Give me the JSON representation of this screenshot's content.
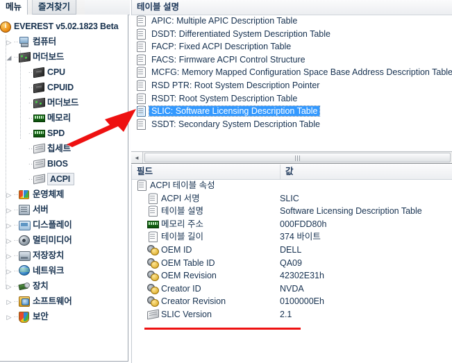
{
  "window": {
    "title": "EVEREST v5.02.1823 Beta"
  },
  "sidebar": {
    "tabs": [
      {
        "label": "메뉴",
        "active": true
      },
      {
        "label": "즐겨찾기",
        "active": false
      }
    ],
    "root": {
      "label": "EVEREST v5.02.1823 Beta",
      "icon": "info-icon"
    },
    "items": [
      {
        "label": "컴퓨터",
        "icon": "computer-icon",
        "level": 1,
        "expander": "collapsed",
        "selected": false
      },
      {
        "label": "머더보드",
        "icon": "motherboard-icon",
        "level": 1,
        "expander": "expanded",
        "selected": false
      },
      {
        "label": "CPU",
        "icon": "cpu-icon",
        "level": 2,
        "expander": "none",
        "selected": false
      },
      {
        "label": "CPUID",
        "icon": "cpu-icon",
        "level": 2,
        "expander": "none",
        "selected": false
      },
      {
        "label": "머더보드",
        "icon": "motherboard-icon",
        "level": 2,
        "expander": "none",
        "selected": false
      },
      {
        "label": "메모리",
        "icon": "memory-icon",
        "level": 2,
        "expander": "none",
        "selected": false
      },
      {
        "label": "SPD",
        "icon": "memory-icon",
        "level": 2,
        "expander": "none",
        "selected": false
      },
      {
        "label": "칩세트",
        "icon": "chipset-icon",
        "level": 2,
        "expander": "none",
        "selected": false
      },
      {
        "label": "BIOS",
        "icon": "chipset-icon",
        "level": 2,
        "expander": "none",
        "selected": false
      },
      {
        "label": "ACPI",
        "icon": "chipset-icon",
        "level": 2,
        "expander": "none",
        "selected": true
      },
      {
        "label": "운영체제",
        "icon": "windows-icon",
        "level": 1,
        "expander": "collapsed",
        "selected": false
      },
      {
        "label": "서버",
        "icon": "server-icon",
        "level": 1,
        "expander": "collapsed",
        "selected": false
      },
      {
        "label": "디스플레이",
        "icon": "display-icon",
        "level": 1,
        "expander": "collapsed",
        "selected": false
      },
      {
        "label": "멀티미디어",
        "icon": "multimedia-icon",
        "level": 1,
        "expander": "collapsed",
        "selected": false
      },
      {
        "label": "저장장치",
        "icon": "storage-icon",
        "level": 1,
        "expander": "collapsed",
        "selected": false
      },
      {
        "label": "네트워크",
        "icon": "network-icon",
        "level": 1,
        "expander": "collapsed",
        "selected": false
      },
      {
        "label": "장치",
        "icon": "device-icon",
        "level": 1,
        "expander": "collapsed",
        "selected": false
      },
      {
        "label": "소프트웨어",
        "icon": "software-icon",
        "level": 1,
        "expander": "collapsed",
        "selected": false
      },
      {
        "label": "보안",
        "icon": "security-icon",
        "level": 1,
        "expander": "collapsed",
        "selected": false
      }
    ]
  },
  "table_list": {
    "header": "테이블 설명",
    "rows": [
      {
        "label": "APIC: Multiple APIC Description Table",
        "selected": false
      },
      {
        "label": "DSDT: Differentiated System Description Table",
        "selected": false
      },
      {
        "label": "FACP: Fixed ACPI Description Table",
        "selected": false
      },
      {
        "label": "FACS: Firmware ACPI Control Structure",
        "selected": false
      },
      {
        "label": "MCFG: Memory Mapped Configuration Space Base Address Description Table",
        "selected": false
      },
      {
        "label": "RSD PTR: Root System Description Pointer",
        "selected": false
      },
      {
        "label": "RSDT: Root System Description Table",
        "selected": false
      },
      {
        "label": "SLIC: Software Licensing Description Table",
        "selected": true
      },
      {
        "label": "SSDT: Secondary System Description Table",
        "selected": false
      }
    ]
  },
  "scrollbar": {
    "left_arrow": "◄",
    "grip": "|||"
  },
  "detail": {
    "headers": {
      "field": "필드",
      "value": "값"
    },
    "group": {
      "label": "ACPI 테이블 속성",
      "icon": "note-icon"
    },
    "rows": [
      {
        "field": "ACPI 서명",
        "value": "SLIC",
        "icon": "note-icon"
      },
      {
        "field": "테이블 설명",
        "value": "Software Licensing Description Table",
        "icon": "note-icon"
      },
      {
        "field": "메모리 주소",
        "value": "000FDD80h",
        "icon": "memory-icon"
      },
      {
        "field": "테이블 길이",
        "value": "374 바이트",
        "icon": "note-icon"
      },
      {
        "field": "OEM ID",
        "value": "DELL",
        "icon": "gears-icon"
      },
      {
        "field": "OEM Table ID",
        "value": "QA09",
        "icon": "gears-icon"
      },
      {
        "field": "OEM Revision",
        "value": "42302E31h",
        "icon": "gears-icon"
      },
      {
        "field": "Creator ID",
        "value": "NVDA",
        "icon": "gears-icon"
      },
      {
        "field": "Creator Revision",
        "value": "0100000Eh",
        "icon": "gears-icon"
      },
      {
        "field": "SLIC Version",
        "value": "2.1",
        "icon": "chipset-icon"
      }
    ]
  },
  "annotations": {
    "arrow": {
      "name": "red-arrow",
      "points_to": "SLIC: Software Licensing Description Table",
      "color": "#ee1111"
    },
    "underline": {
      "name": "red-underline",
      "under": "SLIC Version",
      "color": "#ee1111"
    }
  }
}
